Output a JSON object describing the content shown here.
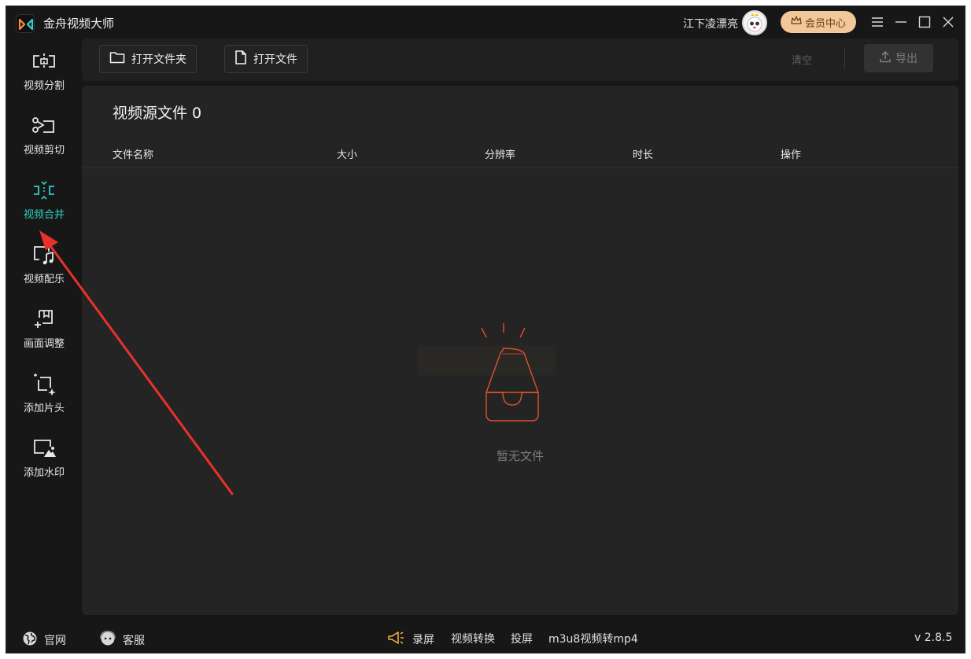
{
  "app": {
    "title": "金舟视频大师",
    "username": "江下凌漂亮",
    "vip_label": "会员中心",
    "accent": "#2bd3c5",
    "vip_color": "#f0c89a",
    "annotation_color": "#e8312b"
  },
  "window_controls": [
    "menu-icon",
    "minimize-icon",
    "maximize-icon",
    "close-icon"
  ],
  "sidebar": {
    "items": [
      {
        "label": "视频分割",
        "icon": "video-split-icon"
      },
      {
        "label": "视频剪切",
        "icon": "scissors-icon"
      },
      {
        "label": "视频合并",
        "icon": "video-merge-icon",
        "active": true
      },
      {
        "label": "视频配乐",
        "icon": "music-icon"
      },
      {
        "label": "画面调整",
        "icon": "adjust-icon"
      },
      {
        "label": "添加片头",
        "icon": "add-intro-icon"
      },
      {
        "label": "添加水印",
        "icon": "watermark-icon"
      }
    ]
  },
  "toolbar": {
    "open_folder": "打开文件夹",
    "open_file": "打开文件",
    "clear": "清空",
    "export": "导出"
  },
  "main": {
    "title": "视频源文件 0",
    "columns": [
      "文件名称",
      "大小",
      "分辨率",
      "时长",
      "操作"
    ],
    "empty_text": "暂无文件"
  },
  "statusbar": {
    "website": "官网",
    "support": "客服",
    "record": "录屏",
    "convert": "视频转换",
    "cast": "投屏",
    "m3u8": "m3u8视频转mp4",
    "version": "v 2.8.5"
  }
}
